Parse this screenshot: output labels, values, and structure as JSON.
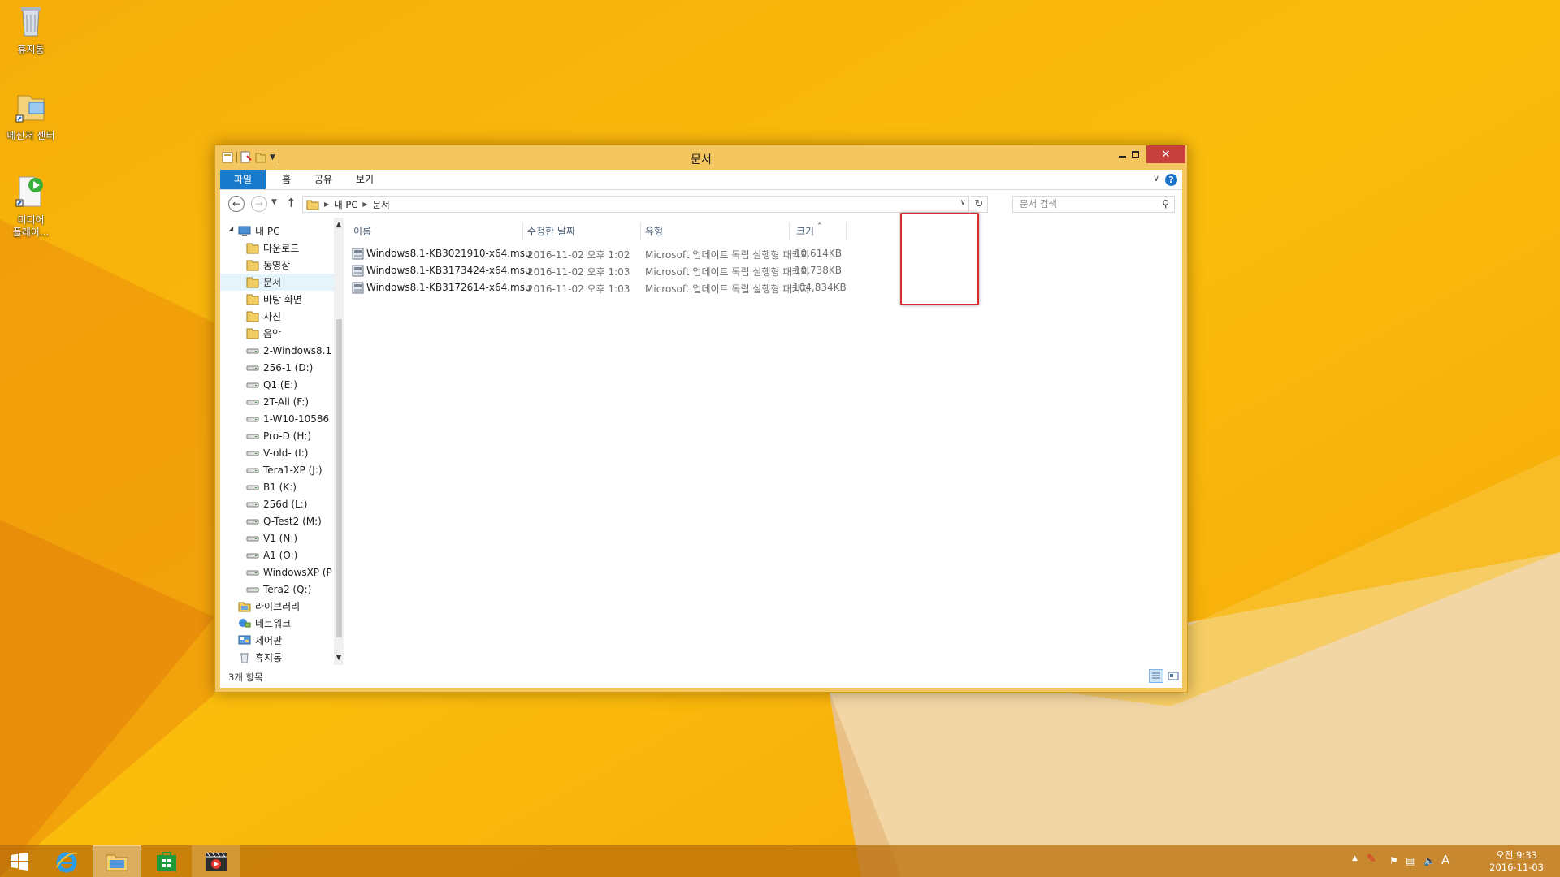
{
  "desktop": {
    "icons": [
      {
        "label": "휴지통"
      },
      {
        "label": "메신저 센터"
      },
      {
        "label": "미디어\n플레이..."
      }
    ]
  },
  "window": {
    "title": "문서",
    "ribbon_tabs": {
      "file": "파일",
      "home": "홈",
      "share": "공유",
      "view": "보기"
    },
    "address": {
      "root": "내 PC",
      "current": "문서"
    },
    "search_placeholder": "문서 검색",
    "tree": [
      {
        "label": "내 PC",
        "icon": "pc-icon"
      },
      {
        "label": "다운로드",
        "icon": "folder-icon"
      },
      {
        "label": "동영상",
        "icon": "folder-icon"
      },
      {
        "label": "문서",
        "icon": "folder-icon",
        "selected": true
      },
      {
        "label": "바탕 화면",
        "icon": "folder-icon"
      },
      {
        "label": "사진",
        "icon": "folder-icon"
      },
      {
        "label": "음악",
        "icon": "folder-icon"
      },
      {
        "label": "2-Windows8.1",
        "icon": "drive-icon"
      },
      {
        "label": "256-1 (D:)",
        "icon": "drive-icon"
      },
      {
        "label": "Q1 (E:)",
        "icon": "drive-icon"
      },
      {
        "label": "2T-All (F:)",
        "icon": "drive-icon"
      },
      {
        "label": "1-W10-10586",
        "icon": "drive-icon"
      },
      {
        "label": "Pro-D (H:)",
        "icon": "drive-icon"
      },
      {
        "label": "V-old- (I:)",
        "icon": "drive-icon"
      },
      {
        "label": "Tera1-XP (J:)",
        "icon": "drive-icon"
      },
      {
        "label": "B1 (K:)",
        "icon": "drive-icon"
      },
      {
        "label": "256d (L:)",
        "icon": "drive-icon"
      },
      {
        "label": "Q-Test2 (M:)",
        "icon": "drive-icon"
      },
      {
        "label": "V1 (N:)",
        "icon": "drive-icon"
      },
      {
        "label": "A1 (O:)",
        "icon": "drive-icon"
      },
      {
        "label": "WindowsXP (P",
        "icon": "drive-icon"
      },
      {
        "label": "Tera2 (Q:)",
        "icon": "drive-icon"
      },
      {
        "label": "라이브러리",
        "icon": "library-icon"
      },
      {
        "label": "네트워크",
        "icon": "network-icon"
      },
      {
        "label": "제어판",
        "icon": "control-panel-icon"
      },
      {
        "label": "휴지통",
        "icon": "recycle-bin-icon"
      }
    ],
    "columns": {
      "name": "이름",
      "date": "수정한 날짜",
      "type": "유형",
      "size": "크기"
    },
    "files": [
      {
        "name": "Windows8.1-KB3021910-x64.msu",
        "date": "2016-11-02 오후 1:02",
        "type": "Microsoft 업데이트 독립 실행형 패키지",
        "size": "10,614KB"
      },
      {
        "name": "Windows8.1-KB3173424-x64.msu",
        "date": "2016-11-02 오후 1:03",
        "type": "Microsoft 업데이트 독립 실행형 패키지",
        "size": "10,738KB"
      },
      {
        "name": "Windows8.1-KB3172614-x64.msu",
        "date": "2016-11-02 오후 1:03",
        "type": "Microsoft 업데이트 독립 실행형 패키지",
        "size": "104,834KB"
      }
    ],
    "status": "3개 항목"
  },
  "taskbar": {
    "clock_time": "오전 9:33",
    "clock_date": "2016-11-03",
    "ime": "A"
  },
  "colors": {
    "accent": "#1979ca",
    "close": "#c7403d",
    "highlight": "#d92b2b",
    "wallpaper": "#f7b700"
  }
}
